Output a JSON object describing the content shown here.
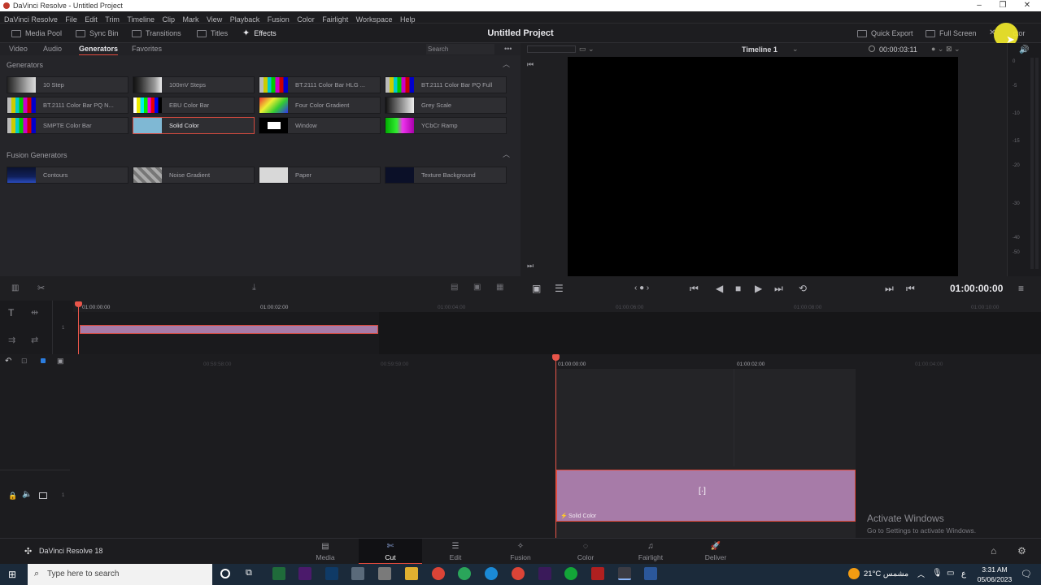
{
  "window": {
    "title": "DaVinci Resolve - Untitled Project",
    "min": "–",
    "max": "❐",
    "close": "✕"
  },
  "menu": [
    "DaVinci Resolve",
    "File",
    "Edit",
    "Trim",
    "Timeline",
    "Clip",
    "Mark",
    "View",
    "Playback",
    "Fusion",
    "Color",
    "Fairlight",
    "Workspace",
    "Help"
  ],
  "toolbar": {
    "media_pool": "Media Pool",
    "sync_bin": "Sync Bin",
    "transitions": "Transitions",
    "titles": "Titles",
    "effects": "Effects",
    "project_title": "Untitled Project",
    "quick_export": "Quick Export",
    "full_screen": "Full Screen",
    "inspector": "ctor"
  },
  "effects_tabs": {
    "video": "Video",
    "audio": "Audio",
    "generators": "Generators",
    "favorites": "Favorites",
    "search_placeholder": "Search",
    "more": "•••"
  },
  "generators": {
    "heading": "Generators",
    "items": [
      {
        "label": "10 Step",
        "thumb": "grey"
      },
      {
        "label": "100mV Steps",
        "thumb": "grey"
      },
      {
        "label": "BT.2111 Color Bar HLG ...",
        "thumb": "bars"
      },
      {
        "label": "BT.2111 Color Bar PQ Full",
        "thumb": "bars"
      },
      {
        "label": "BT.2111 Color Bar PQ N...",
        "thumb": "bars"
      },
      {
        "label": "EBU Color Bar",
        "thumb": "bars"
      },
      {
        "label": "Four Color Gradient",
        "thumb": "gradient"
      },
      {
        "label": "Grey Scale",
        "thumb": "greyscale"
      },
      {
        "label": "SMPTE Color Bar",
        "thumb": "bars"
      },
      {
        "label": "Solid Color",
        "thumb": "solid"
      },
      {
        "label": "Window",
        "thumb": "window"
      },
      {
        "label": "YCbCr Ramp",
        "thumb": "ycbcr"
      }
    ]
  },
  "fusion_generators": {
    "heading": "Fusion Generators",
    "items": [
      {
        "label": "Contours"
      },
      {
        "label": "Noise Gradient"
      },
      {
        "label": "Paper"
      },
      {
        "label": "Texture Background"
      }
    ]
  },
  "viewer": {
    "timeline_name": "Timeline 1",
    "duration": "00:00:03:11",
    "timecode": "01:00:00:00"
  },
  "meter_labels": [
    "0",
    "-5",
    "-10",
    "-15",
    "-20",
    "-30",
    "-40",
    "-50"
  ],
  "upper_ruler": [
    "01:00:00:00",
    "01:00:02:00",
    "01:00:04:00",
    "01:00:06:00",
    "01:00:08:00",
    "01:00:10:00"
  ],
  "lower_ruler": [
    "00:59:58:00",
    "00:59:59:00",
    "01:00:00:00",
    "01:00:02:00",
    "01:00:04:00"
  ],
  "track_number": "1",
  "clip": {
    "label": "Solid Color",
    "color": "#a77ba8"
  },
  "activation": {
    "title": "Activate Windows",
    "subtitle": "Go to Settings to activate Windows."
  },
  "brand": "DaVinci Resolve 18",
  "pages": [
    "Media",
    "Cut",
    "Edit",
    "Fusion",
    "Color",
    "Fairlight",
    "Deliver"
  ],
  "active_page": "Cut",
  "taskbar": {
    "search_placeholder": "Type here to search",
    "weather": "21°C مشمس",
    "lang": "ع",
    "time": "3:31 AM",
    "date": "05/06/2023"
  },
  "colors": {
    "accent_red": "#e24a3c",
    "playhead": "#e8554a",
    "clip": "#a77ba8",
    "solid_thumb": "#7fb8d4"
  }
}
